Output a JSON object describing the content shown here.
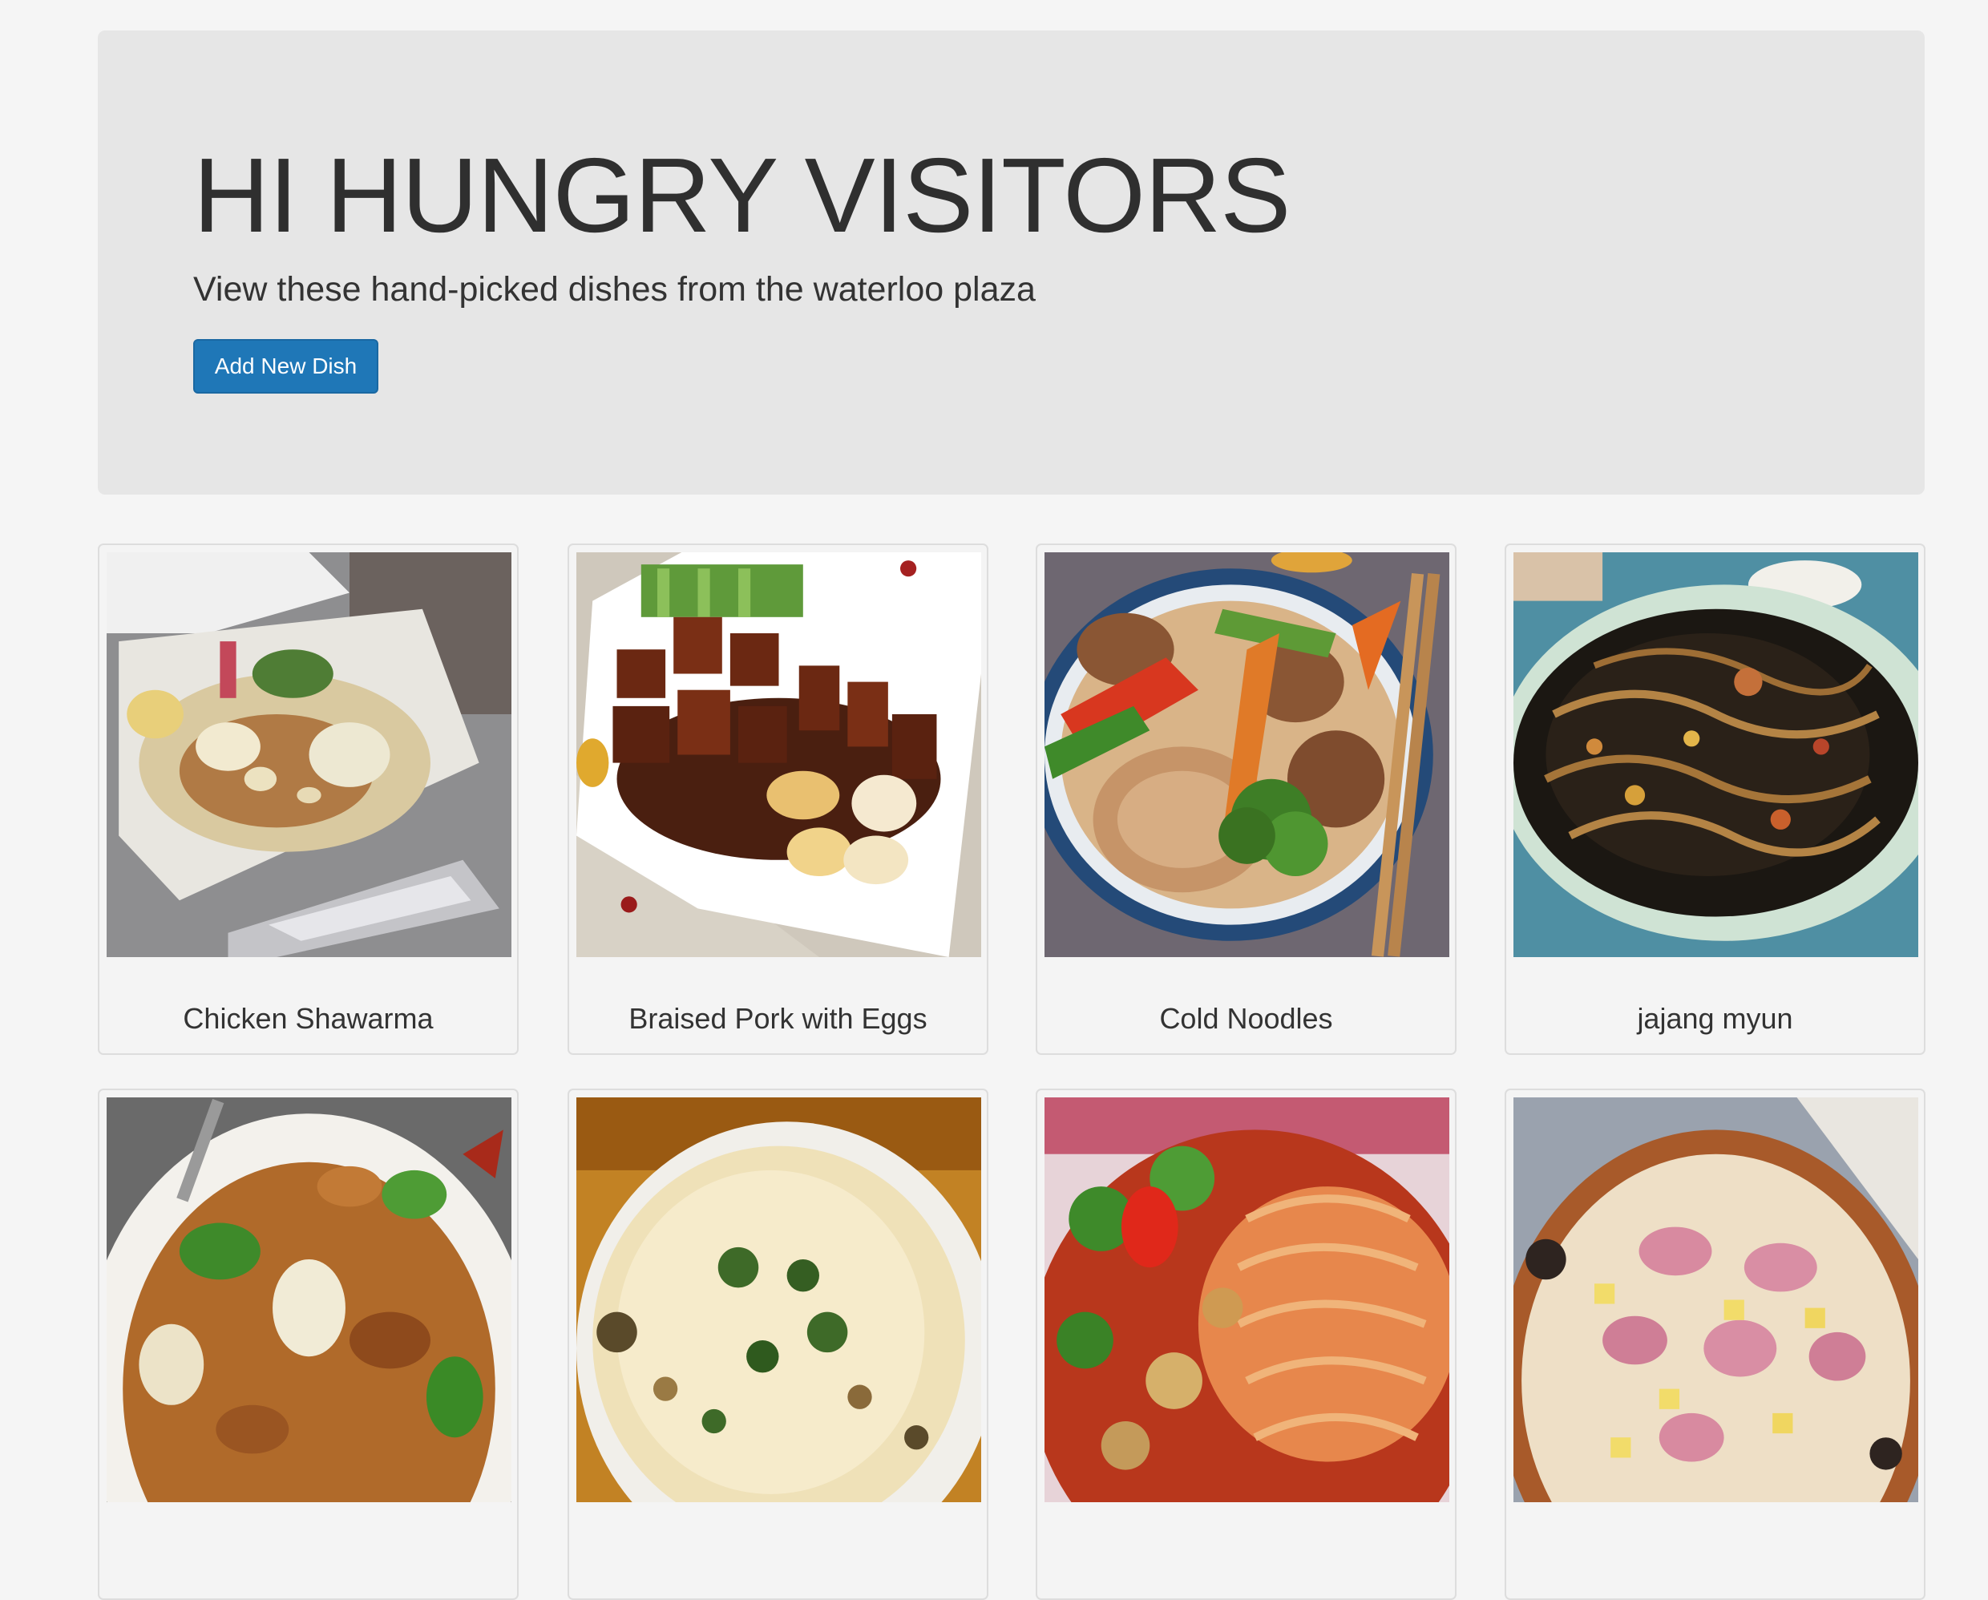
{
  "header": {
    "title": "HI HUNGRY VISITORS",
    "subtitle": "View these hand-picked dishes from the waterloo plaza",
    "add_button_label": "Add New Dish"
  },
  "dishes": [
    {
      "name": "Chicken Shawarma",
      "photo": "chicken-shawarma-photo"
    },
    {
      "name": "Braised Pork with Eggs",
      "photo": "braised-pork-photo"
    },
    {
      "name": "Cold Noodles",
      "photo": "cold-noodles-photo"
    },
    {
      "name": "jajang myun",
      "photo": "jajang-myun-photo"
    },
    {
      "name": "",
      "photo": "stir-fry-photo"
    },
    {
      "name": "",
      "photo": "naan-photo"
    },
    {
      "name": "",
      "photo": "spaghetti-photo"
    },
    {
      "name": "",
      "photo": "pizza-photo"
    }
  ]
}
